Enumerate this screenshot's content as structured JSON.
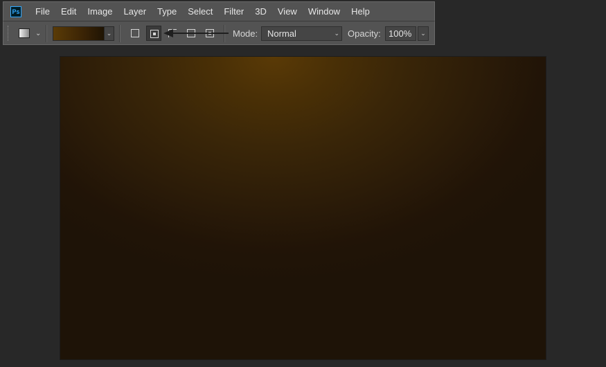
{
  "app": {
    "logo_text": "Ps"
  },
  "menu": [
    "File",
    "Edit",
    "Image",
    "Layer",
    "Type",
    "Select",
    "Filter",
    "3D",
    "View",
    "Window",
    "Help"
  ],
  "options_bar": {
    "gradient_preset_colors": [
      "#5a3b06",
      "#1f1404"
    ],
    "gradient_types": [
      {
        "name": "linear-gradient",
        "active": false
      },
      {
        "name": "radial-gradient",
        "active": true
      },
      {
        "name": "angle-gradient",
        "active": false
      },
      {
        "name": "reflected-gradient",
        "active": false
      },
      {
        "name": "diamond-gradient",
        "active": false
      }
    ],
    "mode_label": "Mode:",
    "mode_value": "Normal",
    "opacity_label": "Opacity:",
    "opacity_value": "100%"
  },
  "canvas": {
    "gradient": {
      "type": "radial",
      "inner_color": "#5a3a06",
      "outer_color": "#1e1307"
    }
  },
  "colors": {
    "workspace": "#282828",
    "panel": "#535353",
    "accent_ps": "#31a8ff"
  }
}
